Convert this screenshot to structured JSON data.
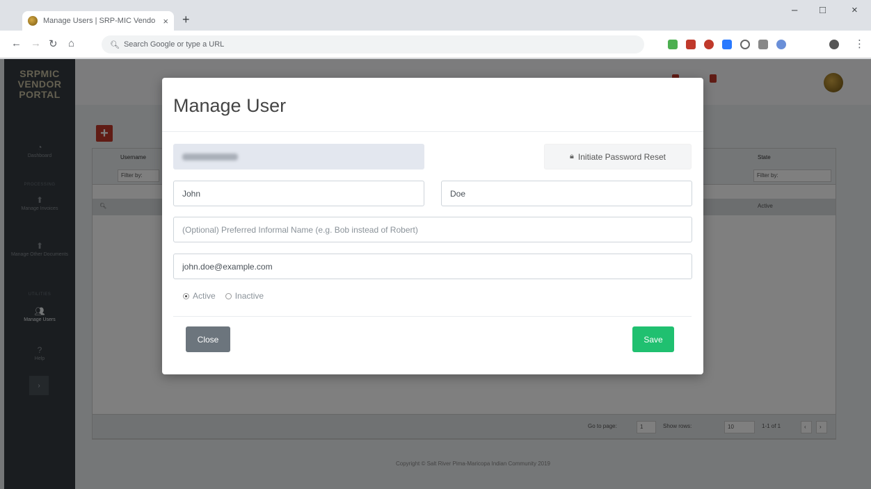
{
  "browser": {
    "tab_title": "Manage Users | SRP-MIC Vendo",
    "tab_close": "×",
    "new_tab": "+",
    "omnibox_placeholder": "Search Google or type a URL",
    "window_controls": [
      "–",
      "□",
      "×"
    ]
  },
  "app": {
    "logo_lines": [
      "SRPMIC",
      "VENDOR",
      "PORTAL"
    ],
    "sidebar": {
      "dashboard": "Dashboard",
      "section_processing": "PROCESSING",
      "manage_invoices": "Manage Invoices",
      "manage_other_docs": "Manage Other Documents",
      "section_utilities": "UTILITIES",
      "manage_users": "Manage Users",
      "help": "Help",
      "toggle": "›"
    },
    "grid": {
      "columns": [
        "Username",
        "State"
      ],
      "filter_placeholder": "Filter by:",
      "row_state": "Active"
    },
    "pager": {
      "go_to_page_label": "Go to page:",
      "page_value": "1",
      "show_rows_label": "Show rows:",
      "rows_value": "10",
      "range": "1-1 of 1",
      "prev": "‹",
      "next": "›"
    },
    "copyright": "Copyright © Salt River Pima-Maricopa Indian Community 2019"
  },
  "modal": {
    "title": "Manage User",
    "reset_button": "Initiate Password Reset",
    "first_name": "John",
    "last_name": "Doe",
    "informal_placeholder": "(Optional) Preferred Informal Name (e.g. Bob instead of Robert)",
    "email": "john.doe@example.com",
    "status_options": [
      "Active",
      "Inactive"
    ],
    "status_selected": "Active",
    "close_button": "Close",
    "save_button": "Save"
  },
  "colors": {
    "save": "#20c070",
    "close": "#6c757d",
    "sidebar": "#343a40",
    "add_button": "#c0392b"
  }
}
